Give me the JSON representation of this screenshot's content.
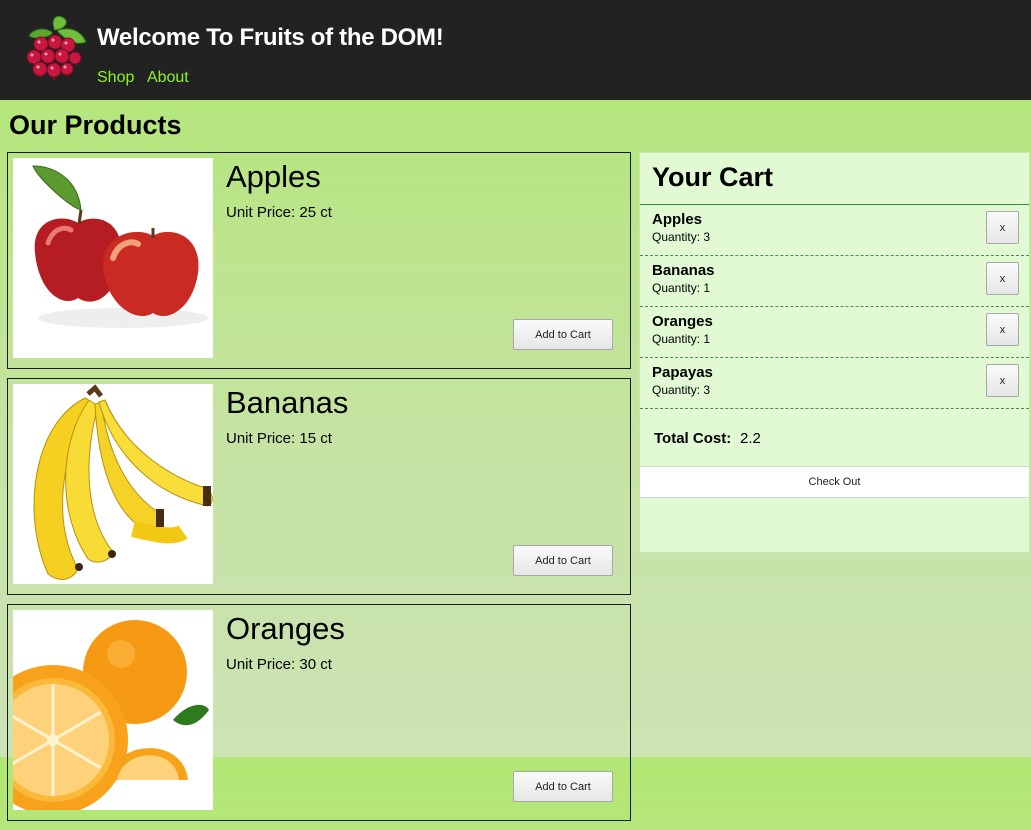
{
  "header": {
    "title": "Welcome To Fruits of the DOM!",
    "logo_icon": "raspberry-logo-icon",
    "nav": [
      {
        "label": "Shop"
      },
      {
        "label": "About"
      }
    ]
  },
  "main": {
    "title": "Our Products",
    "products": [
      {
        "name": "Apples",
        "price": "Unit Price: 25 ct",
        "button": "Add to Cart",
        "image_icon": "apples-image"
      },
      {
        "name": "Bananas",
        "price": "Unit Price: 15 ct",
        "button": "Add to Cart",
        "image_icon": "bananas-image"
      },
      {
        "name": "Oranges",
        "price": "Unit Price: 30 ct",
        "button": "Add to Cart",
        "image_icon": "oranges-image"
      }
    ]
  },
  "cart": {
    "title": "Your Cart",
    "items": [
      {
        "name": "Apples",
        "quantity": "Quantity: 3",
        "remove": "x"
      },
      {
        "name": "Bananas",
        "quantity": "Quantity: 1",
        "remove": "x"
      },
      {
        "name": "Oranges",
        "quantity": "Quantity: 1",
        "remove": "x"
      },
      {
        "name": "Papayas",
        "quantity": "Quantity: 3",
        "remove": "x"
      }
    ],
    "total_label": "Total Cost:",
    "total_value": "2.2",
    "checkout": "Check Out"
  },
  "colors": {
    "header_bg": "#222222",
    "nav_link": "#8ef22a",
    "page_bg_top": "#b1e772",
    "cart_bg": "#e2fad4"
  }
}
